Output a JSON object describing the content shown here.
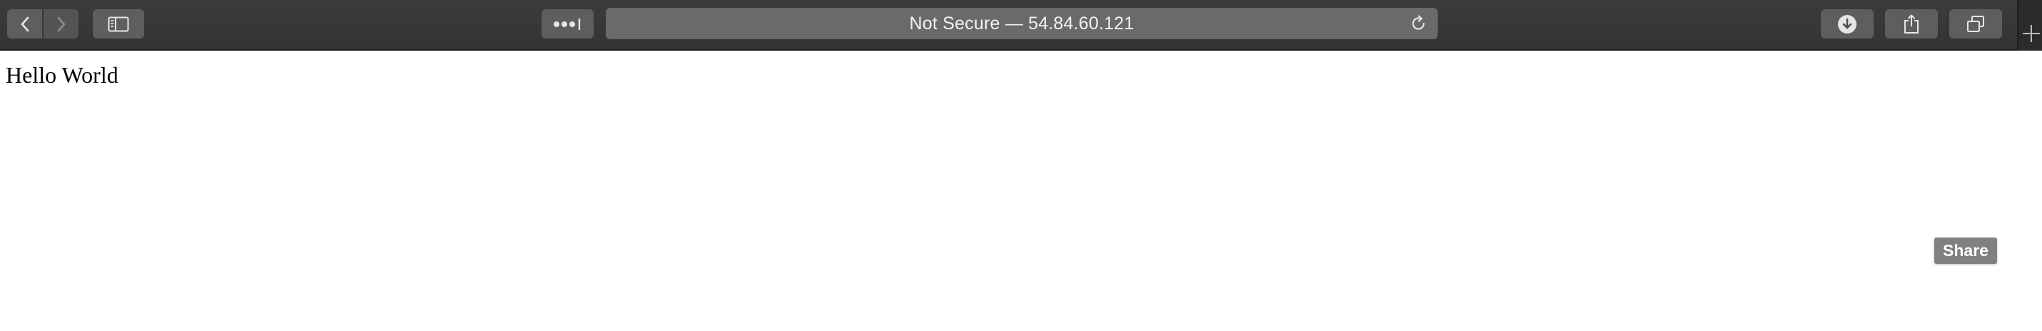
{
  "toolbar": {
    "back_icon": "chevron-left-icon",
    "forward_icon": "chevron-right-icon",
    "sidebar_icon": "sidebar-icon",
    "password_icon": "password-dots-icon",
    "reload_icon": "reload-icon",
    "downloads_icon": "download-icon",
    "share_icon": "share-icon",
    "tabs_icon": "tab-overview-icon",
    "new_tab_icon": "plus-icon"
  },
  "address_bar": {
    "text": "Not Secure — 54.84.60.121"
  },
  "page": {
    "heading": "Hello World"
  },
  "tooltip": {
    "text": "Share"
  }
}
